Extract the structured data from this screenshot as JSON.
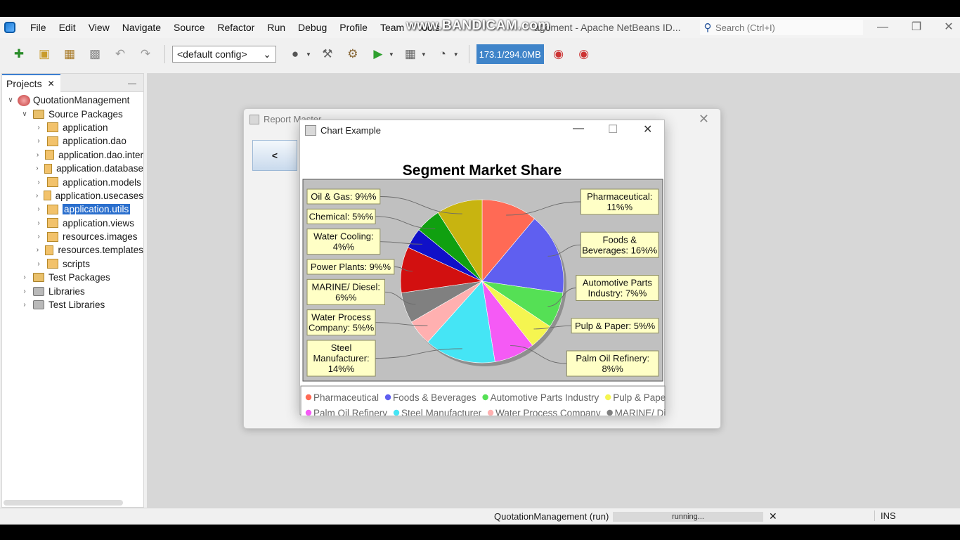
{
  "menu": {
    "items": [
      "File",
      "Edit",
      "View",
      "Navigate",
      "Source",
      "Refactor",
      "Run",
      "Debug",
      "Profile",
      "Team",
      "Tools"
    ],
    "window_title": "agement - Apache NetBeans ID...",
    "watermark": "www.BANDICAM.com",
    "search_placeholder": "Search (Ctrl+I)"
  },
  "toolbar": {
    "config": "<default config>",
    "memory": "173.1/294.0MB"
  },
  "projects": {
    "tab_label": "Projects",
    "tree": [
      {
        "label": "QuotationManagement",
        "level": 0,
        "icon": "project",
        "expanded": true
      },
      {
        "label": "Source Packages",
        "level": 1,
        "icon": "folder",
        "expanded": true
      },
      {
        "label": "application",
        "level": 2,
        "icon": "package"
      },
      {
        "label": "application.dao",
        "level": 2,
        "icon": "package"
      },
      {
        "label": "application.dao.inter",
        "level": 2,
        "icon": "package"
      },
      {
        "label": "application.database",
        "level": 2,
        "icon": "package"
      },
      {
        "label": "application.models",
        "level": 2,
        "icon": "package"
      },
      {
        "label": "application.usecases",
        "level": 2,
        "icon": "package"
      },
      {
        "label": "application.utils",
        "level": 2,
        "icon": "package",
        "selected": true
      },
      {
        "label": "application.views",
        "level": 2,
        "icon": "package"
      },
      {
        "label": "resources.images",
        "level": 2,
        "icon": "package"
      },
      {
        "label": "resources.templates",
        "level": 2,
        "icon": "package"
      },
      {
        "label": "scripts",
        "level": 2,
        "icon": "package"
      },
      {
        "label": "Test Packages",
        "level": 1,
        "icon": "folder"
      },
      {
        "label": "Libraries",
        "level": 1,
        "icon": "library"
      },
      {
        "label": "Test Libraries",
        "level": 1,
        "icon": "library"
      }
    ]
  },
  "report_master": {
    "title": "Report Master",
    "back_label": "<"
  },
  "chart_window": {
    "title": "Chart Example"
  },
  "chart_data": {
    "type": "pie",
    "title": "Segment Market Share",
    "legend_position": "bottom",
    "slices": [
      {
        "name": "Pharmaceutical",
        "value": 11,
        "label": [
          "Pharmaceutical:",
          "11%%"
        ],
        "color": "#ff6a55"
      },
      {
        "name": "Foods & Beverages",
        "value": 16,
        "label": [
          "Foods &",
          "Beverages: 16%%"
        ],
        "color": "#5f5ff0"
      },
      {
        "name": "Automotive Parts Industry",
        "value": 7,
        "label": [
          "Automotive Parts",
          "Industry: 7%%"
        ],
        "color": "#55e055"
      },
      {
        "name": "Pulp & Paper",
        "value": 5,
        "label": [
          "Pulp & Paper: 5%%"
        ],
        "color": "#f5f550"
      },
      {
        "name": "Palm Oil Refinery",
        "value": 8,
        "label": [
          "Palm Oil Refinery:",
          "8%%"
        ],
        "color": "#f55af5"
      },
      {
        "name": "Steel Manufacturer",
        "value": 14,
        "label": [
          "Steel",
          "Manufacturer:",
          "14%%"
        ],
        "color": "#45e5f5"
      },
      {
        "name": "Water Process Company",
        "value": 5,
        "label": [
          "Water Process",
          "Company: 5%%"
        ],
        "color": "#ffb0b0"
      },
      {
        "name": "MARINE/ Diesel",
        "value": 6,
        "label": [
          "MARINE/ Diesel:",
          "6%%"
        ],
        "color": "#808080"
      },
      {
        "name": "Power Plants",
        "value": 9,
        "label": [
          "Power Plants: 9%%"
        ],
        "color": "#d21010"
      },
      {
        "name": "Water Cooling",
        "value": 4,
        "label": [
          "Water Cooling:",
          "4%%"
        ],
        "color": "#1010c8"
      },
      {
        "name": "Chemical",
        "value": 5,
        "label": [
          "Chemical: 5%%"
        ],
        "color": "#10a010"
      },
      {
        "name": "Oil & Gas",
        "value": 9,
        "label": [
          "Oil & Gas: 9%%"
        ],
        "color": "#c8b410"
      }
    ]
  },
  "status": {
    "run_label": "QuotationManagement (run)",
    "progress_text": "running...",
    "mode": "INS"
  }
}
